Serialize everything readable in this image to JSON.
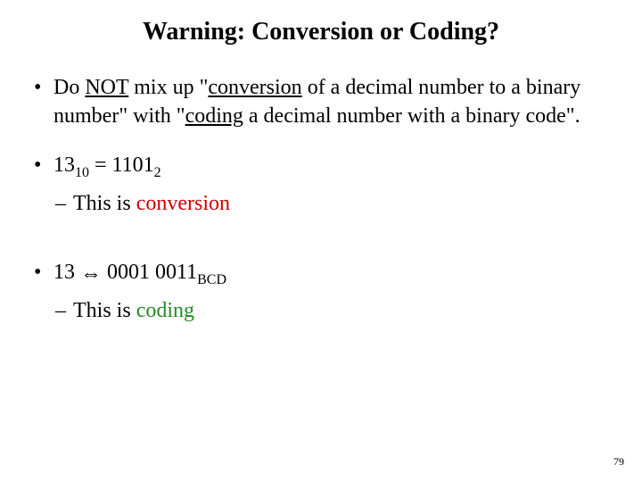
{
  "title": "Warning: Conversion or Coding?",
  "bullet1": {
    "prefix": "Do ",
    "not_underlined": "NOT",
    "mid1": " mix up \"",
    "conversion_underlined": "conversion",
    "mid2": " of a decimal number to a binary number\" with \"",
    "coding_underlined": "coding",
    "suffix": " a decimal number with a binary code\"."
  },
  "bullet2": {
    "value": "13",
    "base1": "10",
    "equals": " = ",
    "binary": "1101",
    "base2": "2"
  },
  "sub2": {
    "prefix": "This is ",
    "emphasis": "conversion"
  },
  "bullet3": {
    "value": "13",
    "arrow": " ⇔ ",
    "bcd": "0001 0011",
    "base": "BCD"
  },
  "sub3": {
    "prefix": "This is ",
    "emphasis": "coding"
  },
  "page_number": "79"
}
